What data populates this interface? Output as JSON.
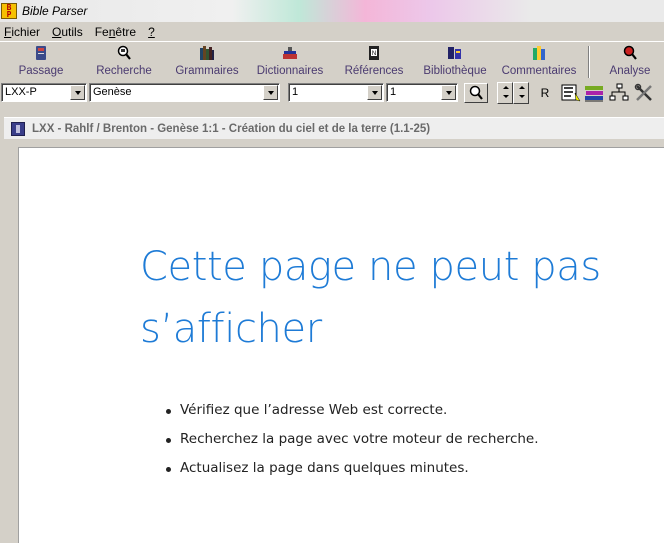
{
  "window": {
    "title": "Bible Parser",
    "icon": "bible-parser-app-icon"
  },
  "menu": [
    {
      "label_ul": "F",
      "label_rest": "ichier"
    },
    {
      "label_ul": "O",
      "label_rest": "utils"
    },
    {
      "label_pre": "Fe",
      "label_ul": "n",
      "label_rest": "être"
    },
    {
      "label_ul": "?",
      "label_rest": ""
    }
  ],
  "toolbar": {
    "passage": "Passage",
    "recherche": "Recherche",
    "grammaires": "Grammaires",
    "dictionnaires": "Dictionnaires",
    "references": "Références",
    "bibliotheque": "Bibliothèque",
    "commentaires": "Commentaires",
    "analyse": "Analyse"
  },
  "selectors": {
    "version": "LXX-P",
    "book": "Genèse",
    "chapter": "1",
    "verse": "1",
    "r_button": "R"
  },
  "document": {
    "title": "LXX - Rahlf / Brenton - Genèse 1:1 - Création du ciel et de la terre (1.1-25)"
  },
  "error_page": {
    "heading": "Cette page ne peut pas s’afficher",
    "bullets": [
      "Vérifiez que l’adresse Web  est correcte.",
      "Recherchez la page avec votre moteur de recherche.",
      "Actualisez la page dans quelques minutes."
    ]
  },
  "colors": {
    "link_blue": "#1e7bd6",
    "toolbar_label": "#4a3a70"
  }
}
